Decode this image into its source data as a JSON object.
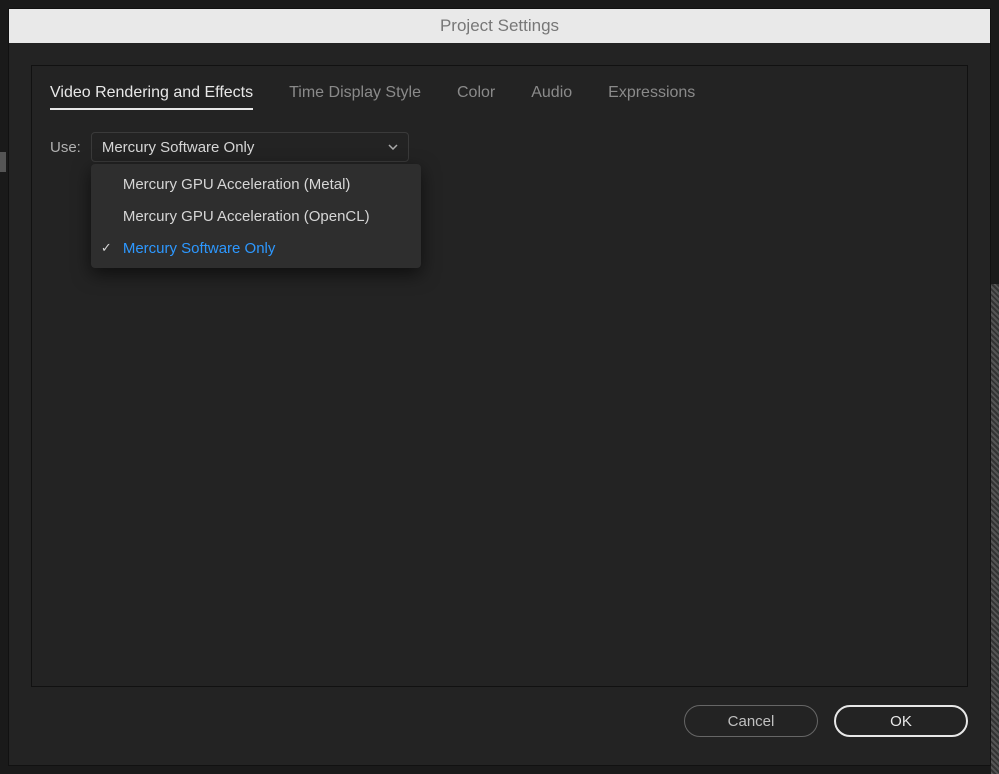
{
  "dialog": {
    "title": "Project Settings",
    "tabs": [
      {
        "label": "Video Rendering and Effects",
        "active": true
      },
      {
        "label": "Time Display Style",
        "active": false
      },
      {
        "label": "Color",
        "active": false
      },
      {
        "label": "Audio",
        "active": false
      },
      {
        "label": "Expressions",
        "active": false
      }
    ],
    "use_label": "Use:",
    "use_select": {
      "value": "Mercury Software Only",
      "options": [
        {
          "label": "Mercury GPU Acceleration (Metal)",
          "selected": false
        },
        {
          "label": "Mercury GPU Acceleration (OpenCL)",
          "selected": false
        },
        {
          "label": "Mercury Software Only",
          "selected": true
        }
      ]
    },
    "buttons": {
      "cancel": "Cancel",
      "ok": "OK"
    }
  }
}
